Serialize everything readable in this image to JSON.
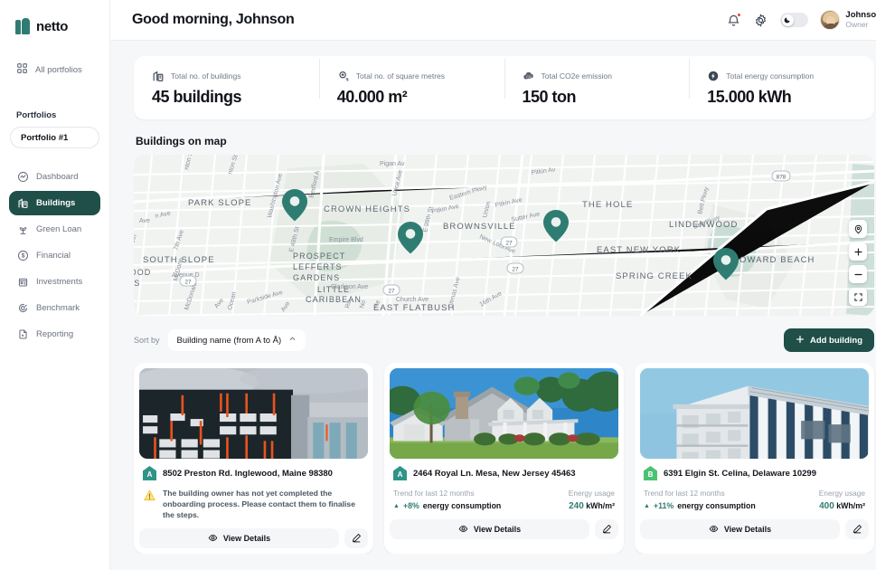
{
  "brand": {
    "name": "netto",
    "color": "#2f7d72",
    "dark": "#1f4f48"
  },
  "sidebar": {
    "all_portfolios": "All portfolios",
    "portfolios_label": "Portfolios",
    "selected_portfolio": "Portfolio #1",
    "nav": [
      {
        "label": "Dashboard",
        "icon": "dashboard-icon",
        "active": false
      },
      {
        "label": "Buildings",
        "icon": "buildings-icon",
        "active": true
      },
      {
        "label": "Green Loan",
        "icon": "green-loan-icon",
        "active": false
      },
      {
        "label": "Financial",
        "icon": "financial-icon",
        "active": false
      },
      {
        "label": "Investments",
        "icon": "investments-icon",
        "active": false
      },
      {
        "label": "Benchmark",
        "icon": "benchmark-icon",
        "active": false
      },
      {
        "label": "Reporting",
        "icon": "reporting-icon",
        "active": false
      }
    ]
  },
  "topbar": {
    "greeting": "Good morning, Johnson",
    "user_name": "Johnson",
    "user_role": "Owner",
    "notification_badge": true
  },
  "stats": [
    {
      "label": "Total no. of buildings",
      "value": "45 buildings",
      "icon": "buildings-stat-icon"
    },
    {
      "label": "Total no. of square metres",
      "value": "40.000 m²",
      "icon": "area-stat-icon"
    },
    {
      "label": "Total CO2e emission",
      "value": "150 ton",
      "icon": "co2-stat-icon"
    },
    {
      "label": "Total energy consumption",
      "value": "15.000 kWh",
      "icon": "energy-stat-icon"
    }
  ],
  "map": {
    "title": "Buildings on map",
    "pin_color": "#2f7d72",
    "neighborhoods": [
      "PARK SLOPE",
      "CROWN HEIGHTS",
      "THE HOLE",
      "BROWNSVILLE",
      "LINDENWOOD",
      "SOUTH SLOPE",
      "PROSPECT LEFFERTS GARDENS",
      "EAST NEW YORK",
      "HOWARD BEACH",
      "LITTLE CARIBBEAN",
      "SPRING CREEK",
      "EAST FLATBUSH"
    ],
    "streets": [
      "Washington Ave",
      "Bedford Ave",
      "Utica Ave",
      "Empire Blvd",
      "Clarkson Ave",
      "Church Ave",
      "Parkside Ave",
      "7th Ave",
      "Pitkin Ave",
      "Sutter Ave",
      "New Lots Ave",
      "Eastern Pkwy",
      "Belt Pkwy",
      "Avenue D",
      "Ocean Ave",
      "Ditmas Ave"
    ],
    "route_shields": [
      "27",
      "27",
      "27",
      "27",
      "878"
    ],
    "controls": [
      "locate-icon",
      "zoom-in-icon",
      "zoom-out-icon",
      "fullscreen-icon"
    ],
    "pins": 4
  },
  "sort": {
    "label": "Sort by",
    "value": "Building name (from A to Å)",
    "add_button": "Add building"
  },
  "cards": [
    {
      "address": "8502 Preston Rd. Inglewood, Maine 98380",
      "rating": "A",
      "rating_color": "#2f9487",
      "image": "dark-office-building",
      "warning": "The building owner has not yet completed the onboarding process. Please contact them to finalise the steps.",
      "view_label": "View Details"
    },
    {
      "address": "2464 Royal Ln. Mesa, New Jersey 45463",
      "rating": "A",
      "rating_color": "#2f9487",
      "image": "suburban-house",
      "trend_label": "Trend for last 12 months",
      "trend_value": "+8%",
      "trend_suffix": "energy consumption",
      "usage_label": "Energy usage",
      "usage_value": "240",
      "usage_unit": "kWh/m²",
      "view_label": "View Details"
    },
    {
      "address": "6391 Elgin St. Celina, Delaware 10299",
      "rating": "B",
      "rating_color": "#4ac274",
      "image": "modern-apartment-block",
      "trend_label": "Trend for last 12 months",
      "trend_value": "+11%",
      "trend_suffix": "energy consumption",
      "usage_label": "Energy usage",
      "usage_value": "400",
      "usage_unit": "kWh/m²",
      "view_label": "View Details"
    }
  ]
}
